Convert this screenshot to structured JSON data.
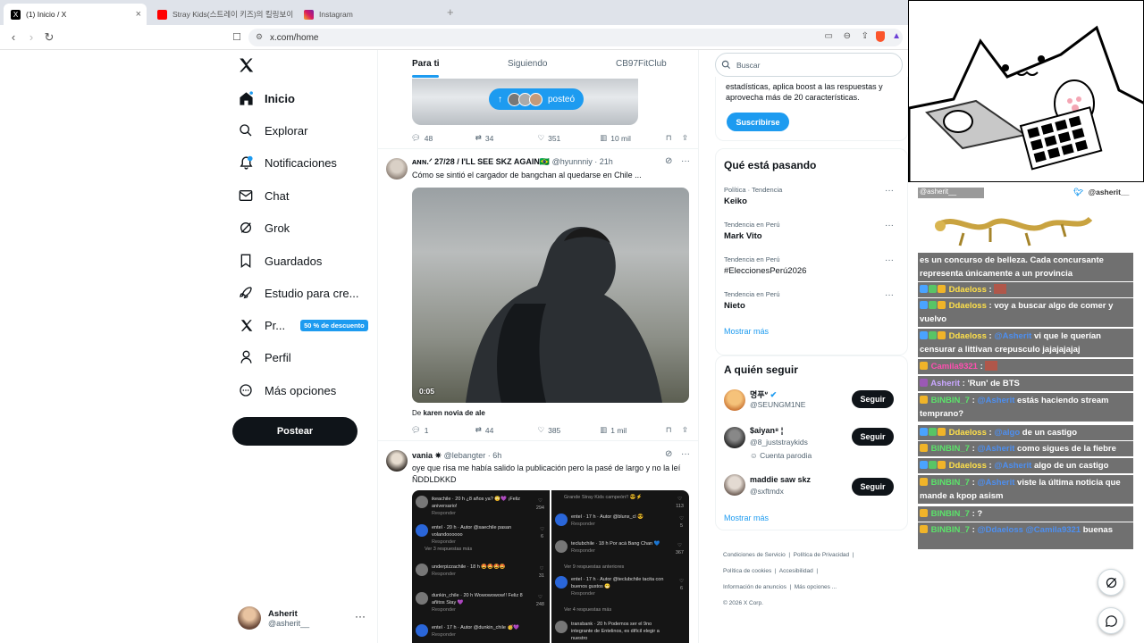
{
  "browser": {
    "tabs": [
      {
        "label": "(1) Inicio / X",
        "active": true
      },
      {
        "label": "Stray Kids(스트레이 키즈)의 킬링보이",
        "active": false
      },
      {
        "label": "Instagram",
        "active": false
      }
    ],
    "url": "x.com/home"
  },
  "nav": {
    "items": [
      {
        "label": "Inicio",
        "icon": "home-icon"
      },
      {
        "label": "Explorar",
        "icon": "search-icon"
      },
      {
        "label": "Notificaciones",
        "icon": "bell-icon"
      },
      {
        "label": "Chat",
        "icon": "mail-icon"
      },
      {
        "label": "Grok",
        "icon": "grok-icon"
      },
      {
        "label": "Guardados",
        "icon": "bookmark-icon"
      },
      {
        "label": "Estudio para cre...",
        "icon": "rocket-icon"
      },
      {
        "label": "Pr...",
        "icon": "x-icon"
      },
      {
        "label": "Perfil",
        "icon": "person-icon"
      },
      {
        "label": "Más opciones",
        "icon": "more-circle-icon"
      }
    ],
    "premium_badge": "50 % de descuento",
    "post_button": "Postear",
    "account": {
      "name": "Asherit",
      "handle": "@asherit__"
    }
  },
  "feed": {
    "tabs": [
      "Para ti",
      "Siguiendo",
      "CB97FitClub"
    ],
    "new_posts_pill": "posteó",
    "post0": {
      "replies": "48",
      "reposts": "34",
      "likes": "351",
      "views": "10 mil"
    },
    "post1": {
      "author": "ᴀɴɴ.ᐟ 27/28 / I'LL SEE SKZ AGAIN🇧🇷",
      "handle": "@hyunnniy · 21h",
      "text": "Cómo se sintió el cargador de bangchan al quedarse en Chile ...",
      "video_time": "0:05",
      "from_prefix": "De",
      "from_name": "karen novia de ale",
      "replies": "1",
      "reposts": "44",
      "likes": "385",
      "views": "1 mil"
    },
    "post2": {
      "author": "vania ✷",
      "handle": "@lebangter · 6h",
      "text": "oye que risa me había salido la publicación pero la pasé de largo y no la leí ÑDDLDKKD",
      "left_comments": [
        {
          "user": "ikeachile",
          "meta": "20 h",
          "text": "¿8 años ya? 😳💜 ¡Feliz aniversario!",
          "count": "294"
        },
        {
          "user": "entel",
          "meta": "20 h · Autor",
          "text": "@saechile pasan volandoooooo",
          "count": "6"
        },
        {
          "user": "",
          "meta": "",
          "text": "Ver 3 respuestas más",
          "count": ""
        },
        {
          "user": "underpizzachile",
          "meta": "18 h",
          "text": "🤩🤩🤩🤩",
          "count": "31"
        },
        {
          "user": "dunkin_chile",
          "meta": "20 h",
          "text": "Wowowowow!! Feliz 8 añitos Stay 💜",
          "count": "248"
        },
        {
          "user": "entel",
          "meta": "17 h · Autor",
          "text": "@dunkin_chile 🥳💜",
          "count": ""
        }
      ],
      "right_comments": [
        {
          "user": "",
          "meta": "",
          "text": "Grande Stray Kids campeón!! 😎⚡",
          "count": "113"
        },
        {
          "user": "entel",
          "meta": "17 h · Autor",
          "text": "@blunx_cl 😎",
          "count": "5"
        },
        {
          "user": "teclubchile",
          "meta": "18 h",
          "text": "Por acá Bang Chan 💙",
          "count": "367"
        },
        {
          "user": "",
          "meta": "",
          "text": "Ver 9 respuestas anteriores",
          "count": ""
        },
        {
          "user": "entel",
          "meta": "17 h · Autor",
          "text": "@teclubchile tacita con buenos gustos 😁",
          "count": "6"
        },
        {
          "user": "",
          "meta": "",
          "text": "Ver 4 respuestas más",
          "count": ""
        },
        {
          "user": "transbank",
          "meta": "20 h",
          "text": "Podemos ser el 9no integrante de Entelinos, es difícil elegir a nuestro",
          "count": ""
        }
      ],
      "reply_label": "Responder"
    }
  },
  "right": {
    "search_placeholder": "Buscar",
    "premium_text": "estadísticas, aplica boost a las respuestas y aprovecha más de 20 características.",
    "subscribe": "Suscribirse",
    "trends_title": "Qué está pasando",
    "trends": [
      {
        "sub": "Política · Tendencia",
        "title": "Keiko"
      },
      {
        "sub": "Tendencia en Perú",
        "title": "Mark Vito"
      },
      {
        "sub": "Tendencia en Perú",
        "title": "#EleccionesPerú2026"
      },
      {
        "sub": "Tendencia en Perú",
        "title": "Nieto"
      }
    ],
    "show_more": "Mostrar más",
    "follow_title": "A quién seguir",
    "follows": [
      {
        "name": "명푸ᐡ",
        "handle": "@SEUNGM1NE",
        "extra": ""
      },
      {
        "name": "$aiyan⁸ ¦",
        "handle": "@8_juststraykids",
        "extra": "Cuenta parodia"
      },
      {
        "name": "maddie saw skz",
        "handle": "@sxftmdx",
        "extra": ""
      }
    ],
    "follow_button": "Seguir",
    "footer": [
      "Condiciones de Servicio",
      "Política de Privacidad",
      "Política de cookies",
      "Accesibilidad",
      "Información de anuncios",
      "Más opciones ...",
      "© 2026 X Corp."
    ]
  },
  "overlay": {
    "chat_owner": "@asherit__",
    "header_user": "@asherit__",
    "messages": [
      {
        "user": "",
        "text": "es un concurso de belleza. Cada concursante representa únicamente a un provincia"
      },
      {
        "user": "Ddaeloss",
        "text": ""
      },
      {
        "user": "Ddaeloss",
        "text": "voy a buscar algo de comer y vuelvo"
      },
      {
        "user": "Ddaeloss",
        "mention": "@Asherit",
        "text": "vi que le querían censurar a littivan crepusculo jajajajajaj"
      },
      {
        "user": "Camila9321",
        "text": ""
      },
      {
        "user": "Asherit",
        "text": "'Run' de BTS"
      },
      {
        "user": "BINBIN_7",
        "mention": "@Asherit",
        "text": "estás haciendo stream temprano?"
      },
      {
        "user": "Ddaeloss",
        "mention": "@algo",
        "text": "de un castigo"
      },
      {
        "user": "BINBIN_7",
        "mention": "@Asherit",
        "text": "como sigues de la fiebre"
      },
      {
        "user": "Ddaeloss",
        "mention": "@Asherit",
        "text": "algo de un castigo"
      },
      {
        "user": "BINBIN_7",
        "mention": "@Asherit",
        "text": "viste la última noticia que mande a kpop asism"
      },
      {
        "user": "BINBIN_7",
        "text": "?"
      },
      {
        "user": "BINBIN_7",
        "mention": "@Ddaeloss @Camila9321",
        "text": "buenas"
      }
    ]
  }
}
